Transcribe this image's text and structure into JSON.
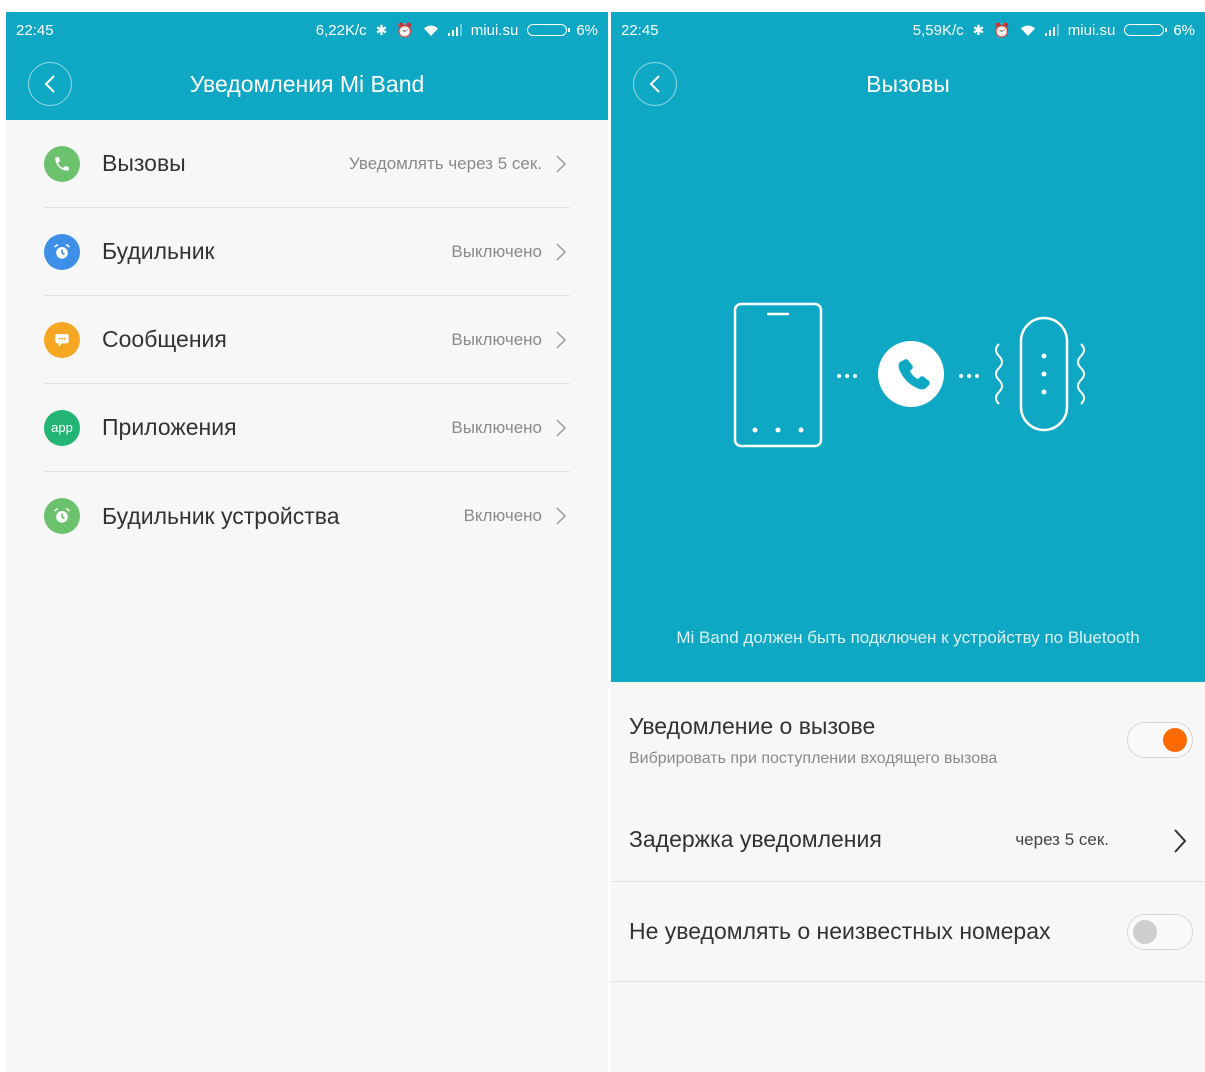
{
  "left_screen": {
    "status_bar": {
      "time": "22:45",
      "speed": "6,22K/c",
      "carrier": "miui.su",
      "battery": "6%"
    },
    "title": "Уведомления Mi Band",
    "items": [
      {
        "label": "Вызовы",
        "value": "Уведомлять через 5 сек.",
        "icon": "phone-icon",
        "color": "#6cc26c"
      },
      {
        "label": "Будильник",
        "value": "Выключено",
        "icon": "alarm-clock-icon",
        "color": "#3d8fe8"
      },
      {
        "label": "Сообщения",
        "value": "Выключено",
        "icon": "message-icon",
        "color": "#f5a623"
      },
      {
        "label": "Приложения",
        "value": "Выключено",
        "icon": "app-icon",
        "icon_text": "app",
        "color": "#22b573"
      },
      {
        "label": "Будильник устройства",
        "value": "Включено",
        "icon": "alarm-clock-icon",
        "color": "#6cc26c"
      }
    ]
  },
  "right_screen": {
    "status_bar": {
      "time": "22:45",
      "speed": "5,59K/c",
      "carrier": "miui.su",
      "battery": "6%"
    },
    "title": "Вызовы",
    "bluetooth_note": "Mi Band должен быть подключен к устройству по Bluetooth",
    "call_notification": {
      "title": "Уведомление о вызове",
      "subtitle": "Вибрировать при поступлении входящего вызова",
      "enabled": true
    },
    "delay": {
      "title": "Задержка уведомления",
      "value": "через 5 сек."
    },
    "unknown_numbers": {
      "title": "Не уведомлять о неизвестных номерах",
      "enabled": false
    }
  },
  "colors": {
    "header": "#0ea8c4",
    "toggle_on": "#ff6a00",
    "toggle_off": "#cfcfcf"
  }
}
